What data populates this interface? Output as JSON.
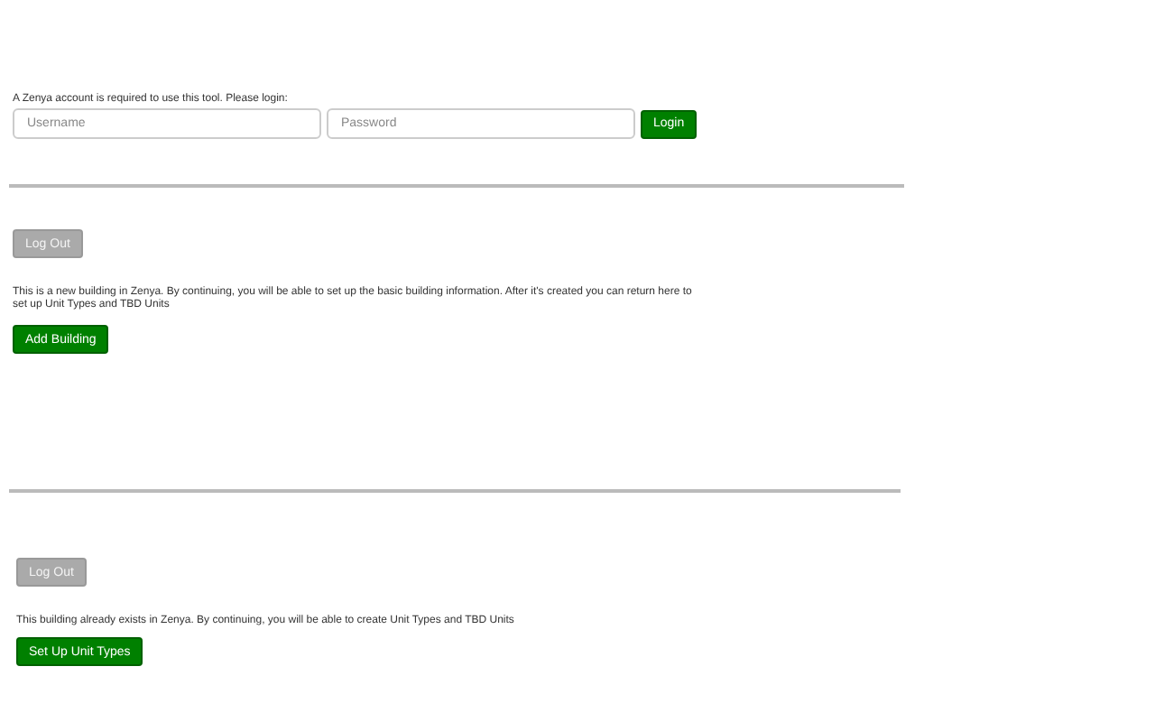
{
  "login": {
    "prompt": "A Zenya account is required to use this tool. Please login:",
    "username": {
      "placeholder": "Username"
    },
    "password": {
      "placeholder": "Password"
    },
    "button": "Login"
  },
  "sections": [
    {
      "logout": "Log Out",
      "message": "This is a new building in Zenya. By continuing, you will be able to set up the basic building information. After it's created you can return here to set up Unit Types and TBD Units",
      "action": "Add Building"
    },
    {
      "logout": "Log Out",
      "message": "This building already exists in Zenya. By continuing, you will be able to create Unit Types and TBD Units",
      "action": "Set Up Unit Types"
    }
  ]
}
